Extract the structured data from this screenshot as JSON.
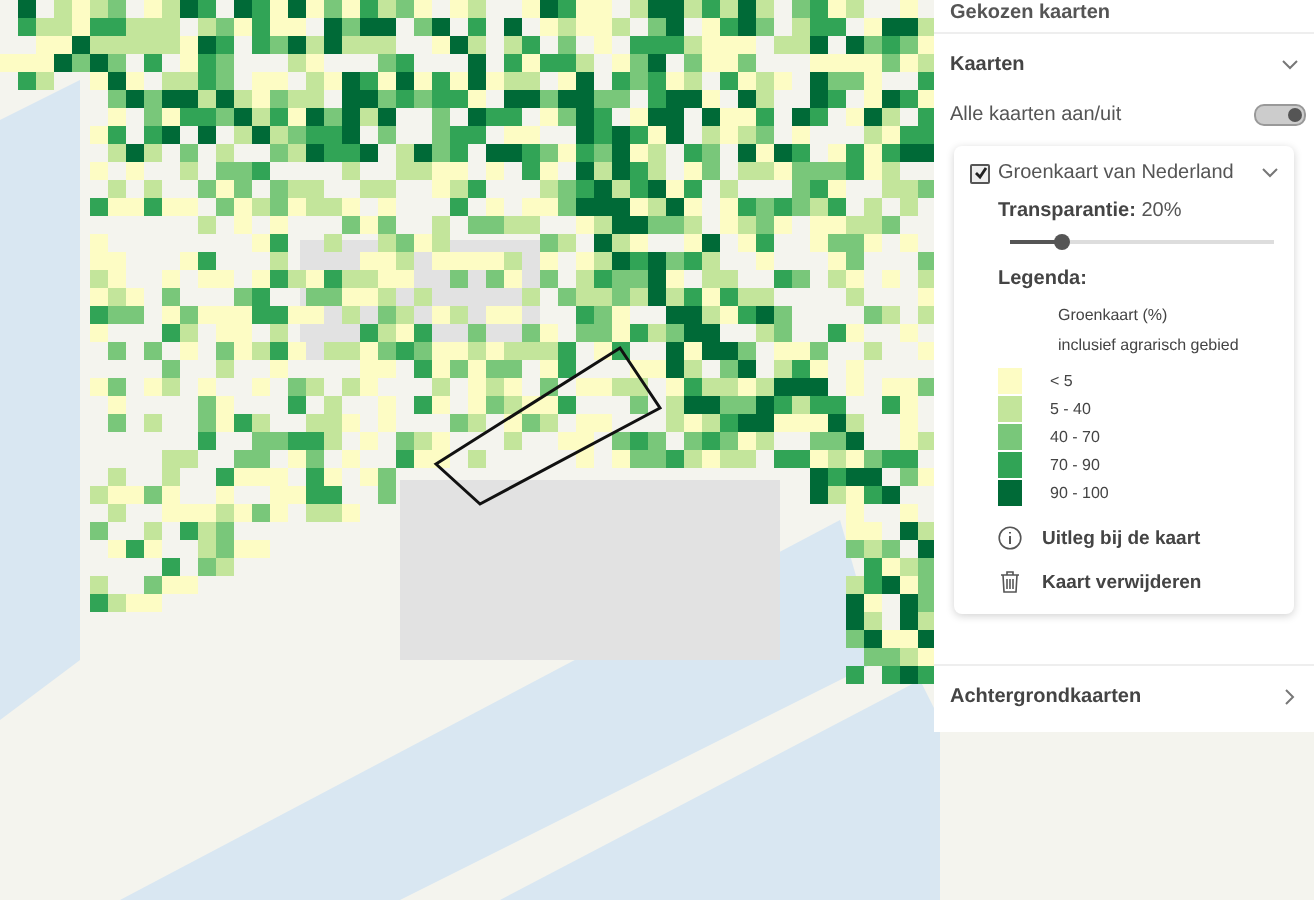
{
  "panel": {
    "title": "Gekozen kaarten",
    "maps_section": {
      "title": "Kaarten",
      "expanded": true,
      "toggle_all": {
        "label": "Alle kaarten aan/uit",
        "on": true
      },
      "layers": [
        {
          "name": "Groenkaart van Nederland",
          "checked": true,
          "expanded": true,
          "transparency_label": "Transparantie:",
          "transparency_value": "20%",
          "level": 0.2,
          "legend_title": "Legenda:",
          "legend_heading": "Groenkaart (%)",
          "legend_subheading": "inclusief agrarisch gebied",
          "legend_items": [
            {
              "label": "< 5",
              "color": "#fdfcc4"
            },
            {
              "label": "5 - 40",
              "color": "#c3e59b"
            },
            {
              "label": "40 - 70",
              "color": "#79c77a"
            },
            {
              "label": "70 - 90",
              "color": "#31a456"
            },
            {
              "label": "90 - 100",
              "color": "#006a37"
            }
          ],
          "actions": [
            {
              "kind": "info",
              "label": "Uitleg bij de kaart"
            },
            {
              "kind": "delete",
              "label": "Kaart verwijderen"
            }
          ]
        }
      ]
    },
    "background_section": {
      "title": "Achtergrondkaarten",
      "expanded": false
    }
  }
}
